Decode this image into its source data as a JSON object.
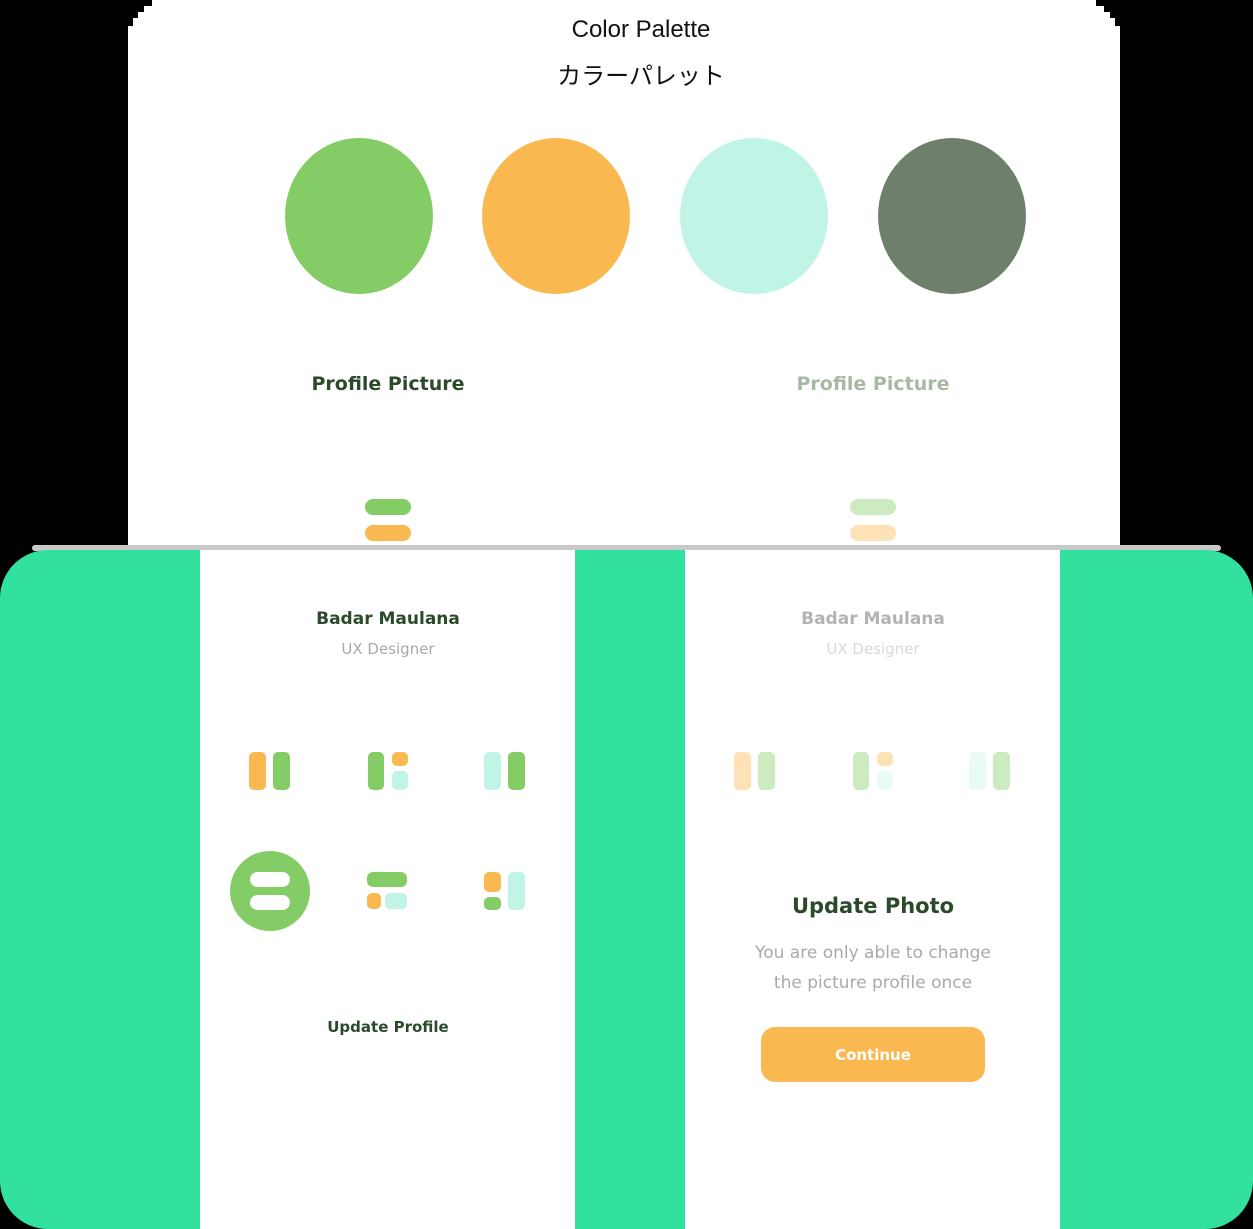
{
  "palette": {
    "title_en": "Color Palette",
    "title_ja": "カラーパレット",
    "colors": [
      "#84CC66",
      "#F9B850",
      "#C0F4E6",
      "#6E806B"
    ]
  },
  "background": {
    "accent": "#32E19E"
  },
  "left_screen": {
    "heading": "Profile Picture",
    "name": "Badar Maulana",
    "role": "UX Designer",
    "action_label": "Update Profile",
    "heading_color": "#2b4a2a"
  },
  "right_screen": {
    "heading": "Profile Picture",
    "name": "Badar Maulana",
    "role": "UX Designer",
    "dialog": {
      "title": "Update Photo",
      "description_line1": "You are only able to change",
      "description_line2": "the picture profile once",
      "button_label": "Continue"
    }
  },
  "avatar_options": [
    "pills-vertical-orange-green",
    "grid-green-orange-mint",
    "pills-mint-green",
    "selected-green-circle",
    "stack-green-orange-mint",
    "grid-orange-green-mint"
  ]
}
